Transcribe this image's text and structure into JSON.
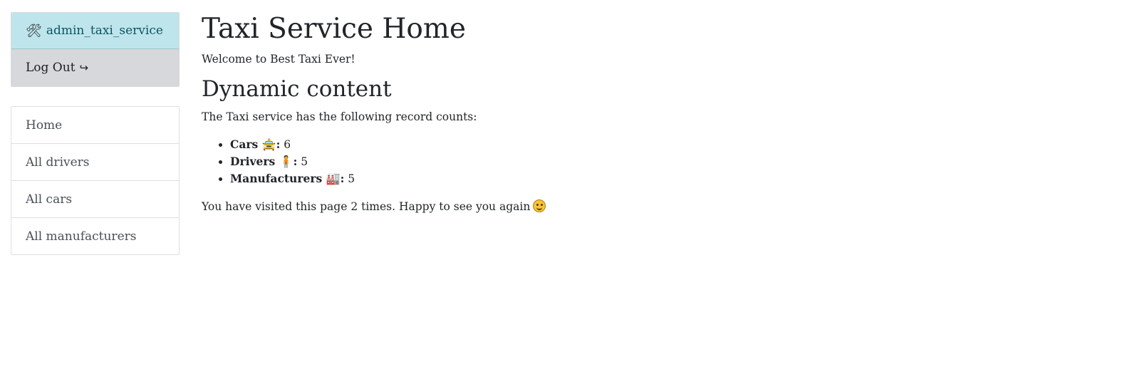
{
  "sidebar": {
    "user": {
      "icon": "tools-icon",
      "icon_glyph": "🛠",
      "username": "admin_taxi_service"
    },
    "logout": {
      "label": "Log Out",
      "icon_glyph": "↪"
    },
    "nav": [
      {
        "label": "Home"
      },
      {
        "label": "All drivers"
      },
      {
        "label": "All cars"
      },
      {
        "label": "All manufacturers"
      }
    ]
  },
  "main": {
    "title": "Taxi Service Home",
    "welcome": "Welcome to Best Taxi Ever!",
    "dynamic_heading": "Dynamic content",
    "counts_intro": "The Taxi service has the following record counts:",
    "counts": [
      {
        "label": "Cars",
        "icon": "taxi-icon",
        "icon_glyph": "🚖",
        "value": "6"
      },
      {
        "label": "Drivers",
        "icon": "person-icon",
        "icon_glyph": "🧍",
        "value": "5"
      },
      {
        "label": "Manufacturers",
        "icon": "factory-icon",
        "icon_glyph": "🏭",
        "value": "5"
      }
    ],
    "visits_text": "You have visited this page 2 times. Happy to see you again",
    "visits_icon": "smiling-face-icon"
  },
  "colors": {
    "user_item_bg": "#bee5eb",
    "user_item_text": "#0c5460",
    "logout_bg": "#d6d8db",
    "text": "#212529"
  }
}
